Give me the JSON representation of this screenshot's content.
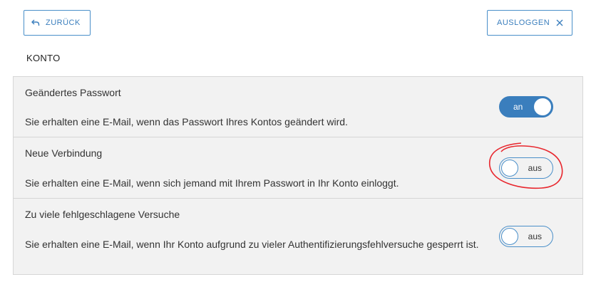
{
  "header": {
    "back_label": "ZURÜCK",
    "logout_label": "AUSLOGGEN"
  },
  "section_title": "KONTO",
  "settings": [
    {
      "title": "Geändertes Passwort",
      "description": "Sie erhalten eine E-Mail, wenn das Passwort Ihres Kontos geändert wird.",
      "state": "an"
    },
    {
      "title": "Neue Verbindung",
      "description": "Sie erhalten eine E-Mail, wenn sich jemand mit Ihrem Passwort in Ihr Konto einloggt.",
      "state": "aus"
    },
    {
      "title": "Zu viele fehlgeschlagene Versuche",
      "description": "Sie erhalten eine E-Mail, wenn Ihr Konto aufgrund zu vieler Authentifizierungsfehlversuche gesperrt ist.",
      "state": "aus"
    }
  ],
  "colors": {
    "accent": "#3a7ebd",
    "panel_background": "#f2f2f2",
    "annotation": "#e8262d"
  },
  "icons": {
    "back": "undo-arrow-icon",
    "logout": "close-icon"
  }
}
